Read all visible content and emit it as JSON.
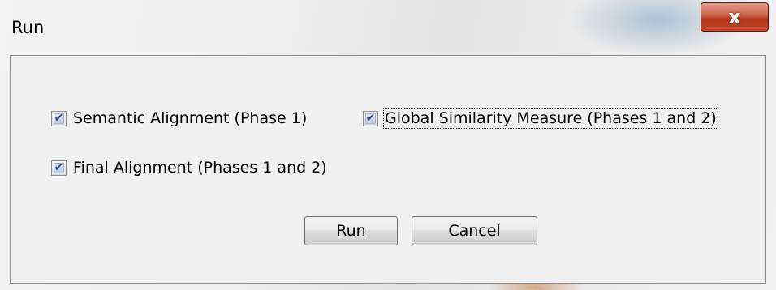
{
  "window": {
    "title": "Run",
    "close_glyph": "x"
  },
  "options": [
    {
      "label": "Semantic Alignment (Phase 1)",
      "checked": true
    },
    {
      "label": "Global Similarity Measure (Phases 1 and 2)",
      "checked": true,
      "focused": true
    },
    {
      "label": "Final Alignment (Phases 1 and 2)",
      "checked": true
    }
  ],
  "buttons": {
    "run_label": "Run",
    "cancel_label": "Cancel"
  },
  "icons": {
    "close": "close-icon",
    "check": "check-icon"
  },
  "colors": {
    "close_button": "#c4472c",
    "check": "#2a4a8c",
    "client_bg": "#f0f0f0"
  }
}
